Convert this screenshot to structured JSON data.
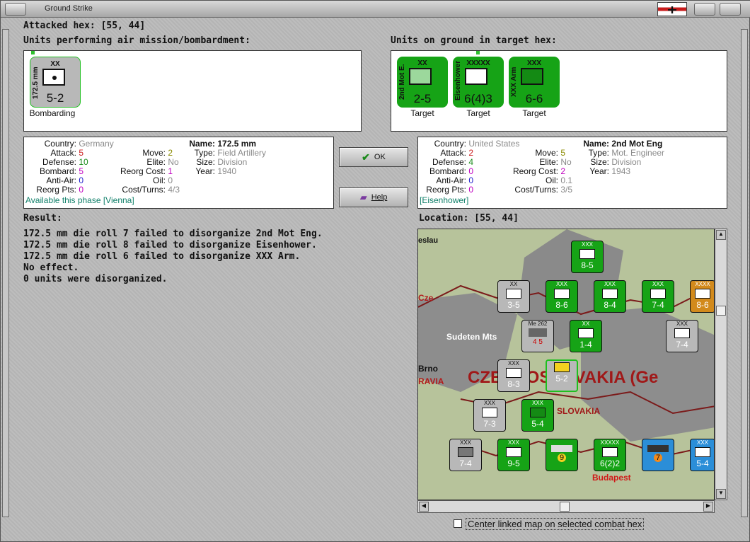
{
  "window": {
    "title": "Ground Strike"
  },
  "attacked_hex": {
    "label": "Attacked hex:",
    "value": "[55, 44]"
  },
  "air_panel": {
    "label": "Units performing air mission/bombardment:",
    "units": [
      {
        "side_text": "172.5 mm",
        "top_text": "XX",
        "value": "5-2",
        "caption": "Bombarding",
        "color": "#b8b8b8"
      }
    ]
  },
  "ground_panel": {
    "label": "Units on ground in target hex:",
    "units": [
      {
        "side_text": "2nd Mot E.",
        "top_text": "XX",
        "value": "2-5",
        "caption": "Target",
        "color": "#16a316"
      },
      {
        "side_text": "Eisenhower",
        "top_text": "XXXXX",
        "value": "6(4)3",
        "caption": "Target",
        "color": "#16a316"
      },
      {
        "side_text": "XXX Arm",
        "top_text": "XXX",
        "value": "6-6",
        "caption": "Target",
        "color": "#16a316"
      }
    ]
  },
  "left_info": {
    "country_label": "Country:",
    "country": "Germany",
    "attack_label": "Attack:",
    "attack": "5",
    "defense_label": "Defense:",
    "defense": "10",
    "bombard_label": "Bombard:",
    "bombard": "5",
    "antiair_label": "Anti-Air:",
    "antiair": "0",
    "reorgpts_label": "Reorg Pts:",
    "reorgpts": "0",
    "move_label": "Move:",
    "move": "2",
    "elite_label": "Elite:",
    "elite": "No",
    "reorgcost_label": "Reorg Cost:",
    "reorgcost": "1",
    "oil_label": "Oil:",
    "oil": "0",
    "costturns_label": "Cost/Turns:",
    "costturns": "4/3",
    "name_label": "Name:",
    "name": "172.5 mm",
    "type_label": "Type:",
    "type": "Field Artillery",
    "size_label": "Size:",
    "size": "Division",
    "year_label": "Year:",
    "year": "1940",
    "footer": "Available this phase [Vienna]"
  },
  "right_info": {
    "country_label": "Country:",
    "country": "United States",
    "attack_label": "Attack:",
    "attack": "2",
    "defense_label": "Defense:",
    "defense": "4",
    "bombard_label": "Bombard:",
    "bombard": "0",
    "antiair_label": "Anti-Air:",
    "antiair": "0",
    "reorgpts_label": "Reorg Pts:",
    "reorgpts": "0",
    "move_label": "Move:",
    "move": "5",
    "elite_label": "Elite:",
    "elite": "No",
    "reorgcost_label": "Reorg Cost:",
    "reorgcost": "2",
    "oil_label": "Oil:",
    "oil": "0.1",
    "costturns_label": "Cost/Turns:",
    "costturns": "3/5",
    "name_label": "Name:",
    "name": "2nd Mot Eng",
    "type_label": "Type:",
    "type": "Mot. Engineer",
    "size_label": "Size:",
    "size": "Division",
    "year_label": "Year:",
    "year": "1943",
    "footer": "[Eisenhower]"
  },
  "buttons": {
    "ok": "OK",
    "help": "Help"
  },
  "result": {
    "label": "Result:",
    "lines": [
      "172.5 mm die roll 7 failed to disorganize 2nd Mot Eng.",
      "172.5 mm die roll 8 failed to disorganize Eisenhower.",
      "172.5 mm die roll 6 failed to disorganize XXX Arm.",
      "No effect.",
      "0 units were disorganized."
    ]
  },
  "location": {
    "label": "Location:",
    "value": "[55, 44]"
  },
  "map": {
    "labels": {
      "city1": "eslau",
      "mts": "Sudeten Mts",
      "brno": "Brno",
      "ravia": "RAVIA",
      "czech": "CZECHOSLOVAKIA (Ge",
      "slovakia": "SLOVAKIA",
      "budapest": "Budapest",
      "cze": "Cze"
    },
    "counters": [
      {
        "top": "XXX",
        "value": "8-5",
        "color": "#16a316"
      },
      {
        "top": "XX",
        "value": "3-5",
        "color": "#b8b8b8"
      },
      {
        "top": "XXX",
        "value": "8-6",
        "color": "#16a316"
      },
      {
        "top": "XXX",
        "value": "8-4",
        "color": "#16a316"
      },
      {
        "top": "XXX",
        "value": "7-4",
        "color": "#16a316"
      },
      {
        "top": "XXXX",
        "value": "8-6",
        "color": "#d28a1c"
      },
      {
        "top": "Me 262",
        "value": "4 5",
        "color": "#b8b8b8"
      },
      {
        "top": "XX",
        "value": "1-4",
        "color": "#16a316"
      },
      {
        "top": "XXX",
        "value": "7-4",
        "color": "#b8b8b8"
      },
      {
        "top": "XXX",
        "value": "8-3",
        "color": "#b8b8b8"
      },
      {
        "top": "",
        "value": "5-2",
        "color": "#b8b8b8"
      },
      {
        "top": "XXX",
        "value": "7-3",
        "color": "#b8b8b8"
      },
      {
        "top": "XXX",
        "value": "5-4",
        "color": "#16a316"
      },
      {
        "top": "XXX",
        "value": "7-4",
        "color": "#b8b8b8"
      },
      {
        "top": "XXX",
        "value": "9-5",
        "color": "#16a316"
      },
      {
        "top": "",
        "value": "9",
        "color": "#16a316"
      },
      {
        "top": "XXXXX",
        "value": "6(2)2",
        "color": "#16a316"
      },
      {
        "top": "",
        "value": "7",
        "color": "#2b8ed8"
      },
      {
        "top": "XXX",
        "value": "5-4",
        "color": "#2b8ed8"
      }
    ]
  },
  "center_checkbox": {
    "label": "Center linked map on selected combat hex"
  }
}
